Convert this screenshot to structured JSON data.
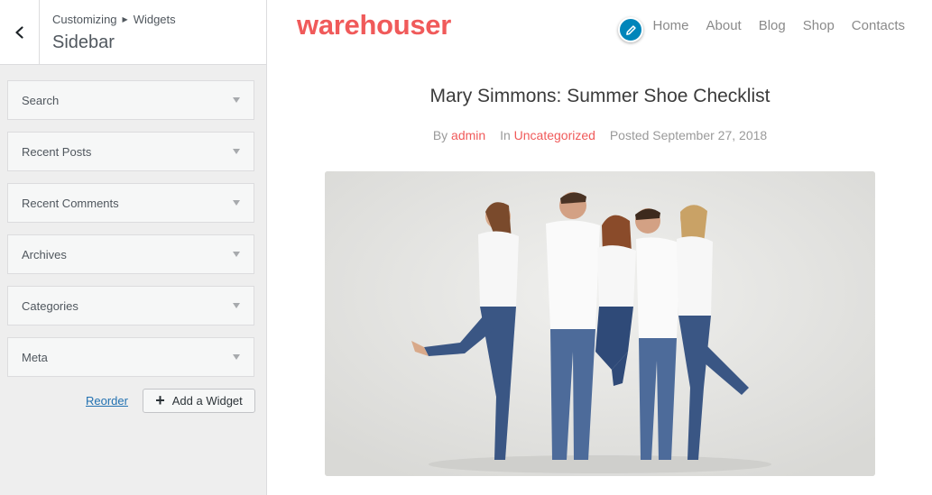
{
  "customizer": {
    "breadcrumb": {
      "parent": "Customizing",
      "current": "Widgets"
    },
    "panel_title": "Sidebar",
    "widgets": [
      {
        "label": "Search"
      },
      {
        "label": "Recent Posts"
      },
      {
        "label": "Recent Comments"
      },
      {
        "label": "Archives"
      },
      {
        "label": "Categories"
      },
      {
        "label": "Meta"
      }
    ],
    "reorder_label": "Reorder",
    "add_widget_label": "Add a Widget"
  },
  "site": {
    "logo": "warehouser",
    "nav": [
      "Home",
      "About",
      "Blog",
      "Shop",
      "Contacts"
    ],
    "post": {
      "title": "Mary Simmons: Summer Shoe Checklist",
      "by_prefix": "By",
      "author": "admin",
      "in_prefix": "In",
      "category": "Uncategorized",
      "posted": "Posted September 27, 2018"
    }
  },
  "colors": {
    "brand": "#f05a5a",
    "customizer_accent": "#0085ba",
    "link": "#2271b1"
  },
  "icons": {
    "back": "chevron-left-icon",
    "edit": "pencil-icon",
    "widget_toggle": "triangle-down-icon",
    "add": "plus-icon"
  }
}
